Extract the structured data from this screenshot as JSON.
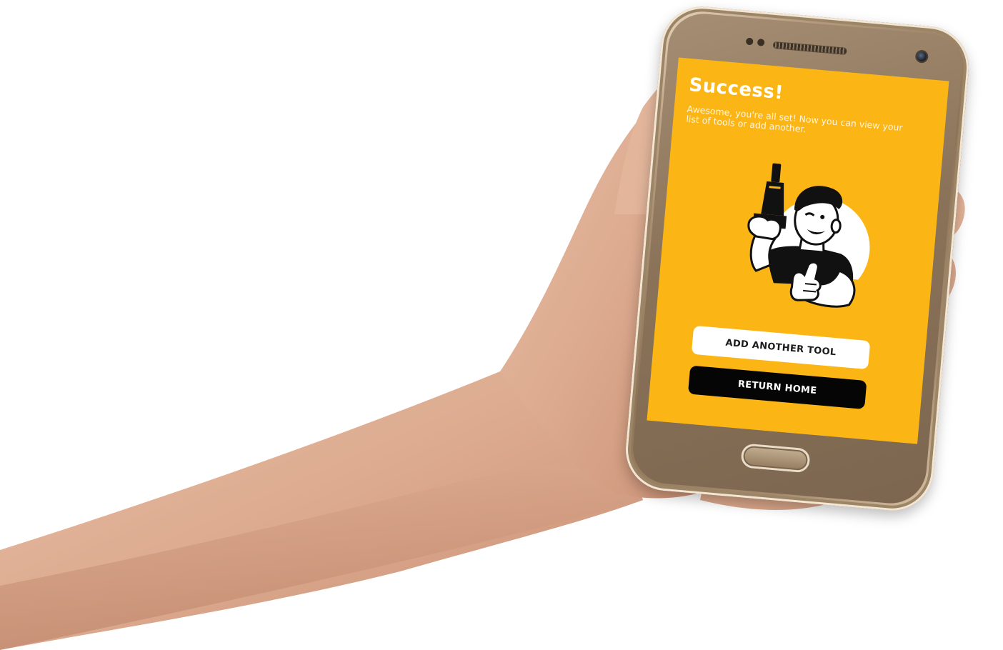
{
  "screen": {
    "title": "Success!",
    "message": "Awesome, you're all set! Now you can view your list of tools or add another.",
    "background_color": "#fbb616"
  },
  "illustration": {
    "icon": "handyman-with-drill-thumbs-up"
  },
  "actions": {
    "add_another_label": "ADD ANOTHER TOOL",
    "return_home_label": "RETURN HOME"
  },
  "device": {
    "type": "smartphone-held-in-hand"
  }
}
